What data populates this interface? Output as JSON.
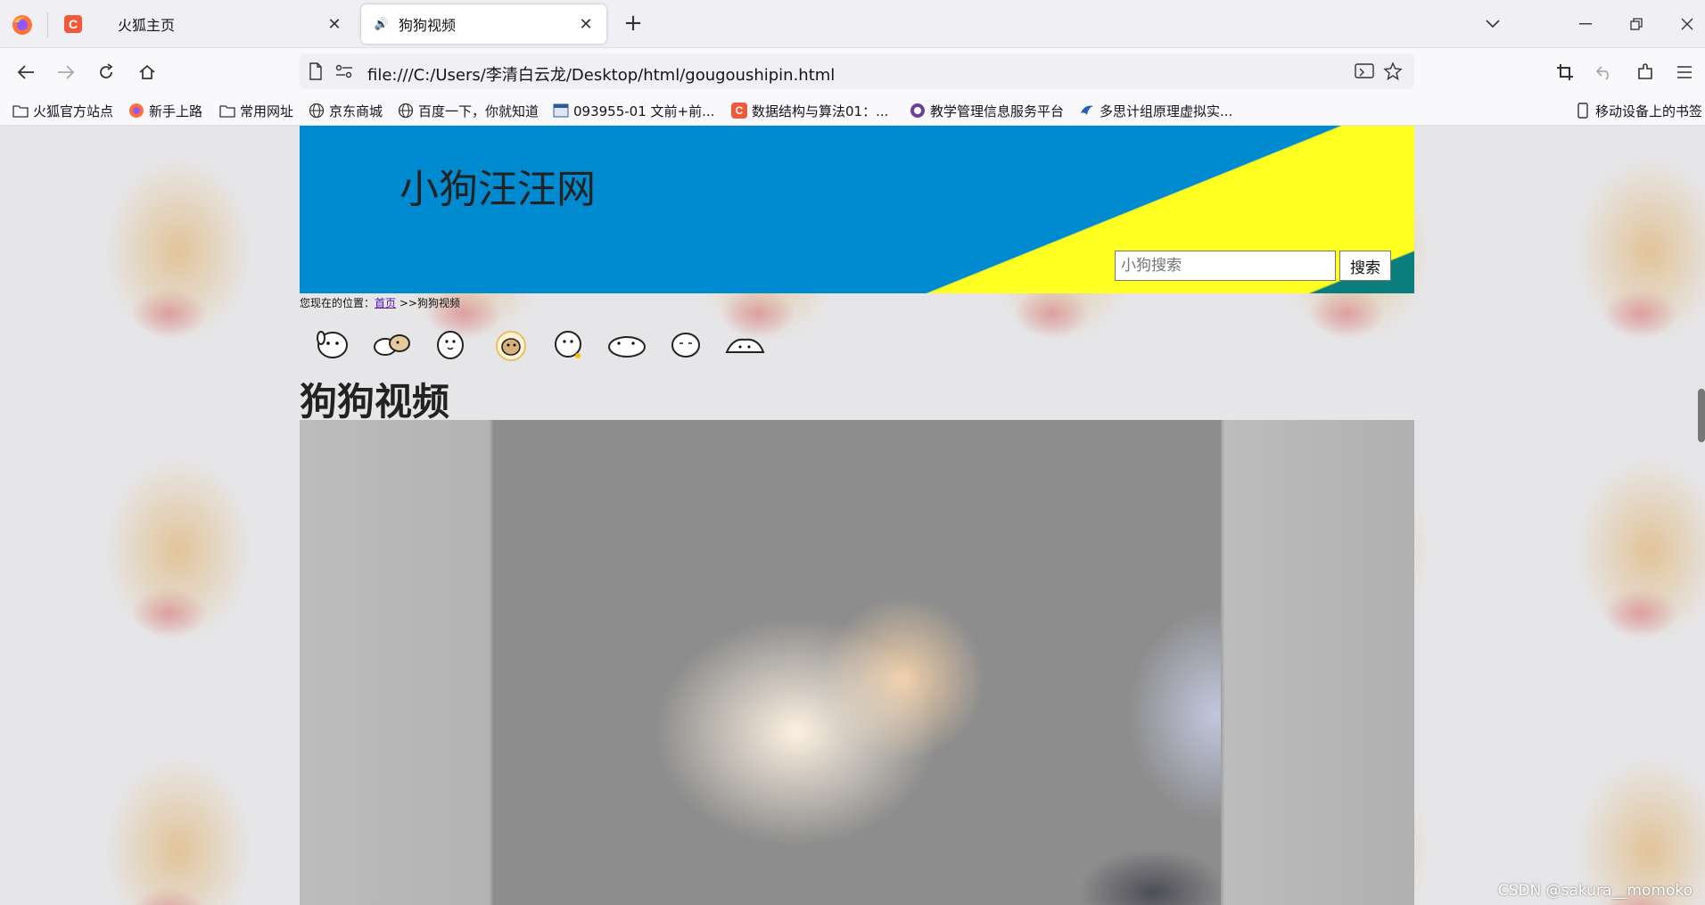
{
  "browser": {
    "tabs": [
      {
        "title": "火狐主页",
        "active": false,
        "favicon": "csdn-c-icon"
      },
      {
        "title": "狗狗视频",
        "active": true,
        "favicon": "speaker-icon"
      }
    ],
    "url": "file:///C:/Users/李清白云龙/Desktop/html/gougoushipin.html",
    "bookmarks": [
      {
        "label": "火狐官方站点",
        "icon": "folder-icon"
      },
      {
        "label": "新手上路",
        "icon": "firefox-icon"
      },
      {
        "label": "常用网址",
        "icon": "folder-icon"
      },
      {
        "label": "京东商城",
        "icon": "globe-icon"
      },
      {
        "label": "百度一下，你就知道",
        "icon": "globe-icon"
      },
      {
        "label": "093955-01 文前+前...",
        "icon": "doc-icon"
      },
      {
        "label": "数据结构与算法01：...",
        "icon": "csdn-c-icon"
      },
      {
        "label": "教学管理信息服务平台",
        "icon": "school-icon"
      },
      {
        "label": "多思计组原理虚拟实...",
        "icon": "bird-icon"
      }
    ],
    "mobile_bookmarks": "移动设备上的书签"
  },
  "page": {
    "site_title": "小狗汪汪网",
    "search": {
      "placeholder": "小狗搜索",
      "button": "搜索"
    },
    "breadcrumb": {
      "prefix": "您现在的位置：",
      "home": "首页",
      "current": ">>狗狗视频"
    },
    "heading": "狗狗视频",
    "watermark": "CSDN @sakura__momoko"
  },
  "colors": {
    "header_blue": "#008ad0",
    "header_yellow": "#ffff22",
    "header_teal": "#0a7d7d",
    "csdn_red": "#f05a3a"
  }
}
